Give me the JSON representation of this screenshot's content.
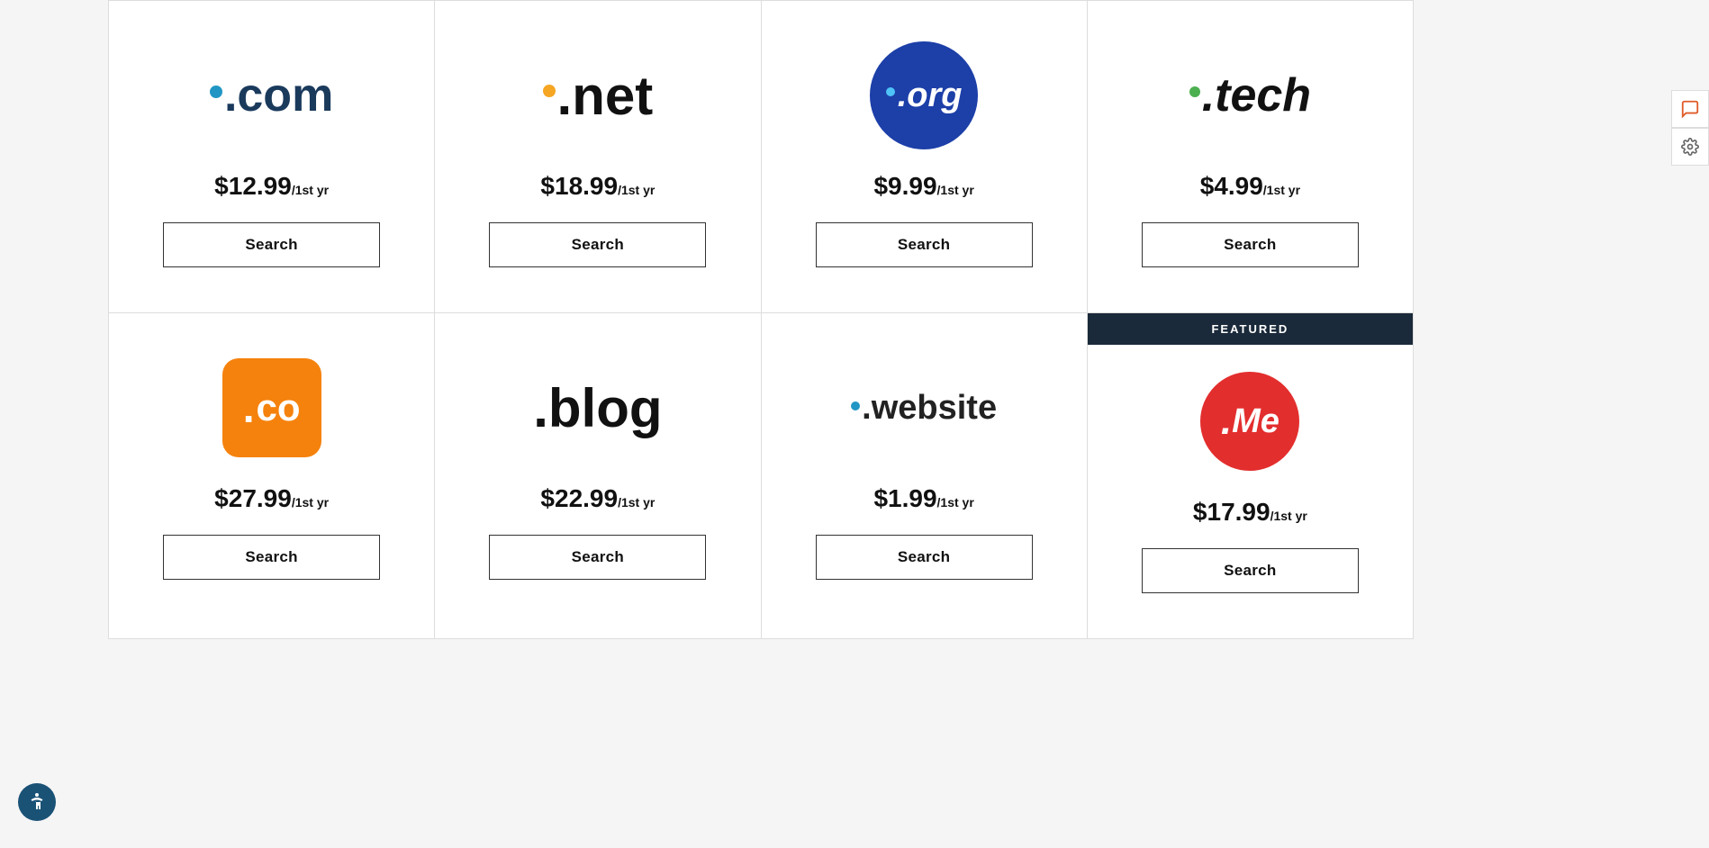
{
  "domains": [
    {
      "id": "com",
      "name": ".com",
      "price_main": "$12.99",
      "price_suffix": "/1st yr",
      "search_label": "Search",
      "featured": false,
      "logo_type": "com"
    },
    {
      "id": "net",
      "name": ".net",
      "price_main": "$18.99",
      "price_suffix": "/1st yr",
      "search_label": "Search",
      "featured": false,
      "logo_type": "net"
    },
    {
      "id": "org",
      "name": ".org",
      "price_main": "$9.99",
      "price_suffix": "/1st yr",
      "search_label": "Search",
      "featured": false,
      "logo_type": "org"
    },
    {
      "id": "tech",
      "name": ".tech",
      "price_main": "$4.99",
      "price_suffix": "/1st yr",
      "search_label": "Search",
      "featured": false,
      "logo_type": "tech"
    },
    {
      "id": "co",
      "name": ".co",
      "price_main": "$27.99",
      "price_suffix": "/1st yr",
      "search_label": "Search",
      "featured": false,
      "logo_type": "co"
    },
    {
      "id": "blog",
      "name": ".blog",
      "price_main": "$22.99",
      "price_suffix": "/1st yr",
      "search_label": "Search",
      "featured": false,
      "logo_type": "blog"
    },
    {
      "id": "website",
      "name": ".website",
      "price_main": "$1.99",
      "price_suffix": "/1st yr",
      "search_label": "Search",
      "featured": false,
      "logo_type": "website"
    },
    {
      "id": "me",
      "name": ".Me",
      "price_main": "$17.99",
      "price_suffix": "/1st yr",
      "search_label": "Search",
      "featured": true,
      "featured_label": "FEATURED",
      "logo_type": "me"
    }
  ],
  "accessibility": {
    "label": "Accessibility"
  },
  "side_tools": {
    "chat_icon": "💬",
    "settings_icon": "⚙"
  }
}
